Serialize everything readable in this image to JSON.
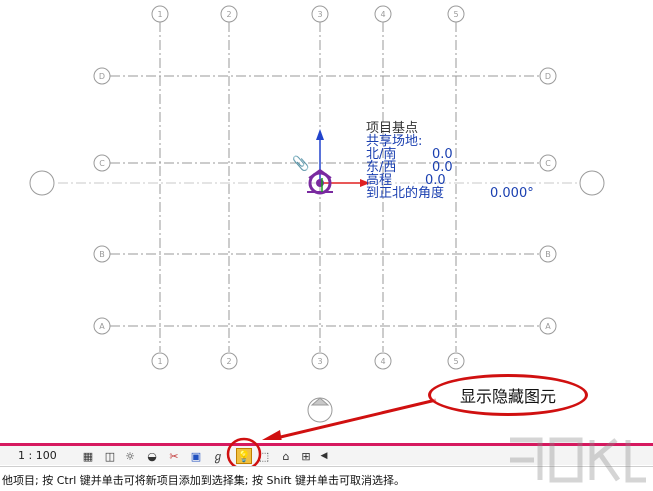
{
  "drawing": {
    "base_point_label": "项目基点",
    "info_lines": [
      {
        "key": "共享场地:",
        "value": ""
      },
      {
        "key": "北/南",
        "value": "0.0"
      },
      {
        "key": "东/西",
        "value": "0.0"
      },
      {
        "key": "高程",
        "value": "0.0"
      },
      {
        "key": "到正北的角度",
        "value": "0.000°"
      }
    ],
    "grid_numbers": [
      "1",
      "2",
      "3",
      "4",
      "5"
    ],
    "grid_letters": [
      "D",
      "C",
      "B",
      "A"
    ]
  },
  "view_control_bar": {
    "scale": "1 : 100",
    "icons": [
      "detail-level-icon",
      "visual-style-icon",
      "sun-path-icon",
      "shadows-icon",
      "crop-view-icon",
      "show-crop-icon",
      "temporary-hide-icon",
      "reveal-hidden-icon",
      "highlight-displacement-icon",
      "temporary-view-properties-icon",
      "analytical-model-icon",
      "collapse-arrow-icon"
    ]
  },
  "status_bar": {
    "text": "他项目; 按 Ctrl 键并单击可将新项目添加到选择集; 按 Shift 键并单击可取消选择。"
  },
  "annotation": {
    "callout_text": "显示隐藏图元"
  },
  "colors": {
    "accent": "#d6195f",
    "annotation_red": "#d01010",
    "info_blue": "#1a3fb0",
    "grid_gray": "#9a9a9a"
  }
}
